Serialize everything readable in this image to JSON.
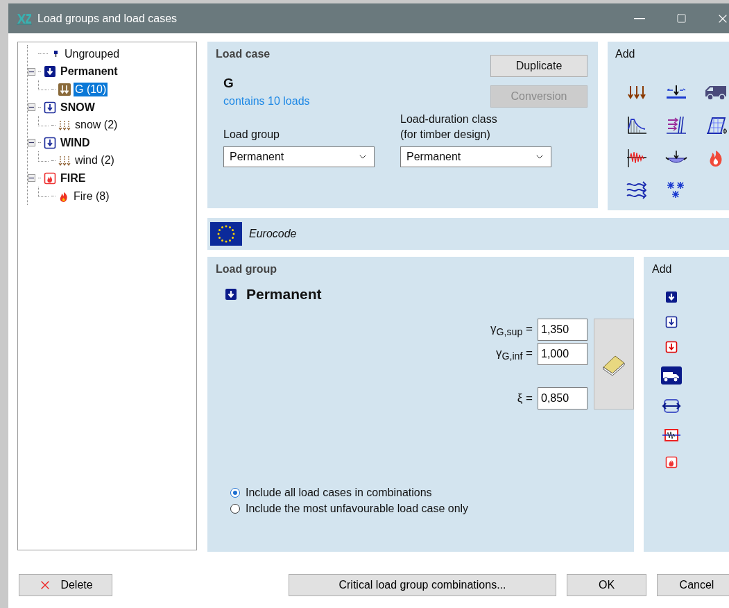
{
  "window": {
    "title": "Load groups and load cases"
  },
  "tree": [
    {
      "label": "Ungrouped",
      "kind": "ungrouped",
      "selected": false
    },
    {
      "label": "Permanent",
      "kind": "permanent",
      "selected": false,
      "expanded": true,
      "children": [
        {
          "label": "G (10)",
          "kind": "permanent",
          "selected": true
        }
      ]
    },
    {
      "label": "SNOW",
      "kind": "variable",
      "selected": false,
      "expanded": true,
      "children": [
        {
          "label": "snow (2)",
          "kind": "variable",
          "selected": false
        }
      ]
    },
    {
      "label": "WIND",
      "kind": "variable",
      "selected": false,
      "expanded": true,
      "children": [
        {
          "label": "wind (2)",
          "kind": "variable",
          "selected": false
        }
      ]
    },
    {
      "label": "FIRE",
      "kind": "fire",
      "selected": false,
      "expanded": true,
      "children": [
        {
          "label": "Fire (8)",
          "kind": "fire",
          "selected": false
        }
      ]
    }
  ],
  "load_case": {
    "heading": "Load case",
    "name": "G",
    "summary": "contains 10 loads",
    "buttons": [
      {
        "label": "Duplicate",
        "disabled": false
      },
      {
        "label": "Conversion",
        "disabled": true
      }
    ],
    "fields": [
      {
        "label_lines": [
          "Load group"
        ],
        "value": "Permanent"
      },
      {
        "label_lines": [
          "Load-duration class",
          "(for timber design)"
        ],
        "value": "Permanent"
      }
    ]
  },
  "add_load_case": {
    "heading": "Add",
    "tools": [
      {
        "kind": "distributed"
      },
      {
        "kind": "point"
      },
      {
        "kind": "vehicle"
      },
      {
        "kind": "spectrum"
      },
      {
        "kind": "earth_pressure"
      },
      {
        "kind": "imperfection"
      },
      {
        "kind": "seismic"
      },
      {
        "kind": "moving"
      },
      {
        "kind": "fire"
      },
      {
        "kind": "wind"
      },
      {
        "kind": "snow"
      }
    ]
  },
  "code": {
    "label": "Eurocode"
  },
  "load_group": {
    "heading": "Load group",
    "name": "Permanent",
    "kind": "permanent",
    "factors": [
      {
        "symbol": "γ$_{G,sup}$ =",
        "value": "1,350"
      },
      {
        "symbol": "γ$_{G,inf}$ =",
        "value": "1,000"
      }
    ],
    "xi": {
      "symbol": "ξ =",
      "value": "0,850"
    },
    "options": [
      {
        "label": "Include all load cases in combinations",
        "selected": true
      },
      {
        "label": "Include the most unfavourable load case only",
        "selected": false
      }
    ]
  },
  "add_load_group": {
    "heading": "Add",
    "tools": [
      {
        "kind": "permanent"
      },
      {
        "kind": "variable"
      },
      {
        "kind": "accidental"
      },
      {
        "kind": "traffic"
      },
      {
        "kind": "prestress"
      },
      {
        "kind": "seismic"
      },
      {
        "kind": "fire"
      }
    ]
  },
  "buttons": [
    {
      "label": "Delete",
      "kind": "delete"
    },
    {
      "label": "Critical load group combinations...",
      "kind": "wide"
    },
    {
      "label": "OK",
      "kind": "normal"
    },
    {
      "label": "Cancel",
      "kind": "normal"
    }
  ]
}
